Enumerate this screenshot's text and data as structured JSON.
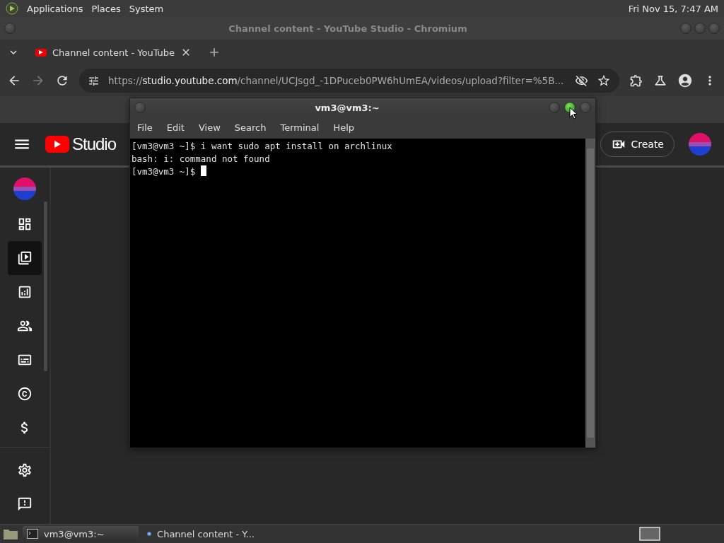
{
  "top_panel": {
    "menus": [
      "Applications",
      "Places",
      "System"
    ],
    "clock": "Fri Nov 15, 7:47 AM"
  },
  "browser": {
    "title": "Channel content - YouTube Studio - Chromium",
    "tabs": [
      {
        "label": "Channel content - YouTube",
        "selected": true
      }
    ],
    "url": {
      "scheme": "https://",
      "host": "studio.youtube.com",
      "path": "/channel/UCJsgd_-1DPuceb0PW6hUmEA/videos/upload?filter=%5B..."
    }
  },
  "studio": {
    "logo": "Studio",
    "create": "Create",
    "sidebar": [
      {
        "kind": "dashboard",
        "selected": false
      },
      {
        "kind": "content",
        "selected": true
      },
      {
        "kind": "analytics",
        "selected": false
      },
      {
        "kind": "community",
        "selected": false
      },
      {
        "kind": "subtitles",
        "selected": false
      },
      {
        "kind": "copyright",
        "selected": false
      },
      {
        "kind": "earn",
        "selected": false
      }
    ],
    "sidebar_bottom": [
      {
        "kind": "settings",
        "selected": false
      },
      {
        "kind": "feedback",
        "selected": false
      }
    ]
  },
  "terminal": {
    "title": "vm3@vm3:~",
    "menus": [
      "File",
      "Edit",
      "View",
      "Search",
      "Terminal",
      "Help"
    ],
    "controls": [
      {
        "hovered": false
      },
      {
        "hovered": true
      },
      {
        "hovered": false
      }
    ],
    "lines": [
      "[vm3@vm3 ~]$ i want sudo apt install on archlinux",
      "bash: i: command not found"
    ],
    "prompt": "[vm3@vm3 ~]$ "
  },
  "taskbar": [
    {
      "kind": "terminal",
      "label": "vm3@vm3:~",
      "selected": true
    },
    {
      "kind": "browser",
      "label": "Channel content - Y...",
      "selected": false
    }
  ]
}
